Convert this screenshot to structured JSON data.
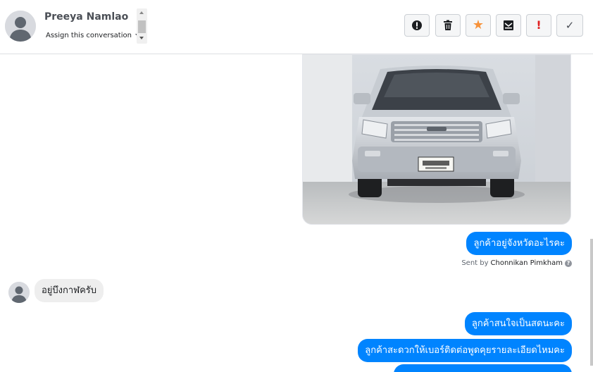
{
  "header": {
    "contact_name": "Preeya Namlao",
    "assign_label": "Assign this conversation",
    "toolbar": [
      {
        "name": "mark-spam-button",
        "icon": "exclamation-circle-icon",
        "glyph": "●"
      },
      {
        "name": "delete-button",
        "icon": "trash-icon",
        "glyph": ""
      },
      {
        "name": "star-button",
        "icon": "star-icon",
        "glyph": "★"
      },
      {
        "name": "mark-unread-button",
        "icon": "envelope-icon",
        "glyph": ""
      },
      {
        "name": "important-button",
        "icon": "exclamation-icon",
        "glyph": "!"
      },
      {
        "name": "mark-done-button",
        "icon": "checkmark-icon",
        "glyph": "✓"
      }
    ]
  },
  "messages": {
    "photo_icon": "car-photo",
    "out_1": "ลูกค้าอยู่จังหวัดอะไรคะ",
    "sent_by_prefix": "Sent by",
    "sent_by_name": "Chonnikan Pimkham",
    "in_1": "อยู่บึงกาฬครับ",
    "out_2": "ลูกค้าสนใจเป็นสดนะคะ",
    "out_3": "ลูกค้าสะดวกให้เบอร์ติดต่อพูดคุยรายละเอียดไหมคะ"
  },
  "colors": {
    "accent": "#0084ff",
    "star": "#f7923a",
    "important": "#e02020"
  }
}
